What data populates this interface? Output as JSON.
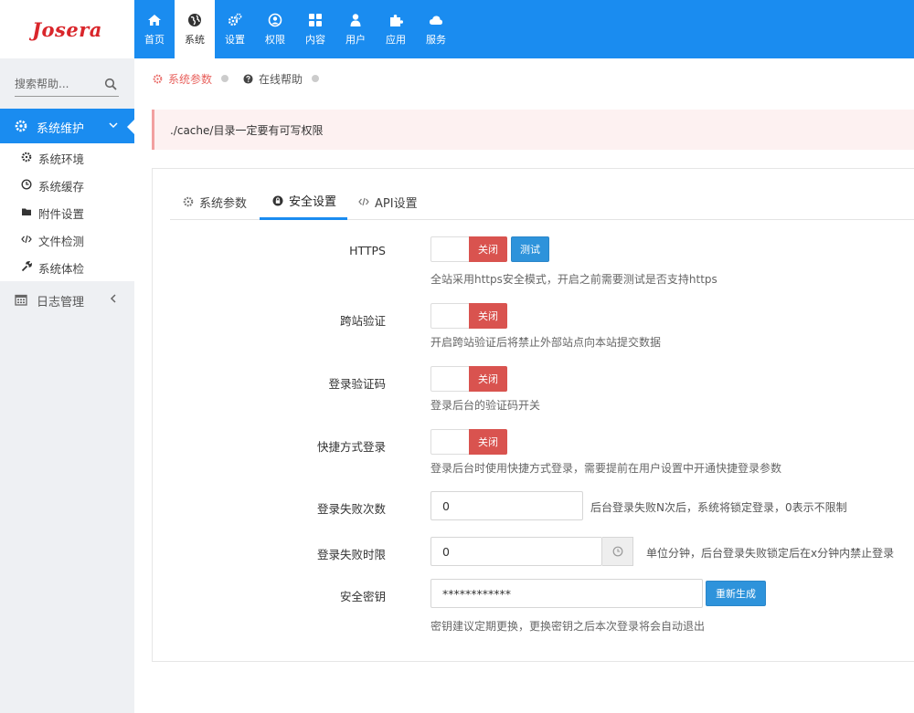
{
  "brand": {
    "logo_text": "Josera",
    "accent": "#1a8cf0"
  },
  "topnav": [
    {
      "label": "首页",
      "icon": "home-icon"
    },
    {
      "label": "系统",
      "icon": "globe-icon",
      "active": true
    },
    {
      "label": "设置",
      "icon": "gears-icon"
    },
    {
      "label": "权限",
      "icon": "user-circle-icon"
    },
    {
      "label": "内容",
      "icon": "grid-icon"
    },
    {
      "label": "用户",
      "icon": "user-icon"
    },
    {
      "label": "应用",
      "icon": "puzzle-icon"
    },
    {
      "label": "服务",
      "icon": "cloud-icon"
    }
  ],
  "sidebar": {
    "search_placeholder": "搜索帮助...",
    "group1": {
      "label": "系统维护",
      "icon": "gear-icon"
    },
    "items": [
      {
        "label": "系统环境",
        "icon": "gear-icon"
      },
      {
        "label": "系统缓存",
        "icon": "clock-icon"
      },
      {
        "label": "附件设置",
        "icon": "folder-icon"
      },
      {
        "label": "文件检测",
        "icon": "code-icon"
      },
      {
        "label": "系统体检",
        "icon": "wrench-icon"
      }
    ],
    "group2": {
      "label": "日志管理",
      "icon": "calendar-icon"
    }
  },
  "breadcrumbs": [
    {
      "label": "系统参数",
      "icon": "gear-icon",
      "active": true
    },
    {
      "label": "在线帮助",
      "icon": "question-icon"
    }
  ],
  "alert": {
    "text": "./cache/目录一定要有可写权限"
  },
  "tabs": [
    {
      "label": "系统参数",
      "icon": "gear-icon"
    },
    {
      "label": "安全设置",
      "icon": "lock-icon",
      "active": true
    },
    {
      "label": "API设置",
      "icon": "code-icon"
    }
  ],
  "form": {
    "https": {
      "label": "HTTPS",
      "toggle": "关闭",
      "test_button": "测试",
      "help": "全站采用https安全模式，开启之前需要测试是否支持https"
    },
    "csrf": {
      "label": "跨站验证",
      "toggle": "关闭",
      "help": "开启跨站验证后将禁止外部站点向本站提交数据"
    },
    "captcha": {
      "label": "登录验证码",
      "toggle": "关闭",
      "help": "登录后台的验证码开关"
    },
    "quick_login": {
      "label": "快捷方式登录",
      "toggle": "关闭",
      "help": "登录后台时使用快捷方式登录，需要提前在用户设置中开通快捷登录参数"
    },
    "fail_count": {
      "label": "登录失败次数",
      "value": "0",
      "help": "后台登录失败N次后，系统将锁定登录，0表示不限制"
    },
    "fail_time": {
      "label": "登录失败时限",
      "value": "0",
      "help": "单位分钟，后台登录失败锁定后在x分钟内禁止登录"
    },
    "secret_key": {
      "label": "安全密钥",
      "value": "************",
      "regen_button": "重新生成",
      "help": "密钥建议定期更换，更换密钥之后本次登录将会自动退出"
    }
  },
  "colors": {
    "danger": "#d9534f",
    "info": "#2e93db",
    "alert_bg": "#fdf1f1",
    "sidebar_bg": "#eef0f3"
  }
}
